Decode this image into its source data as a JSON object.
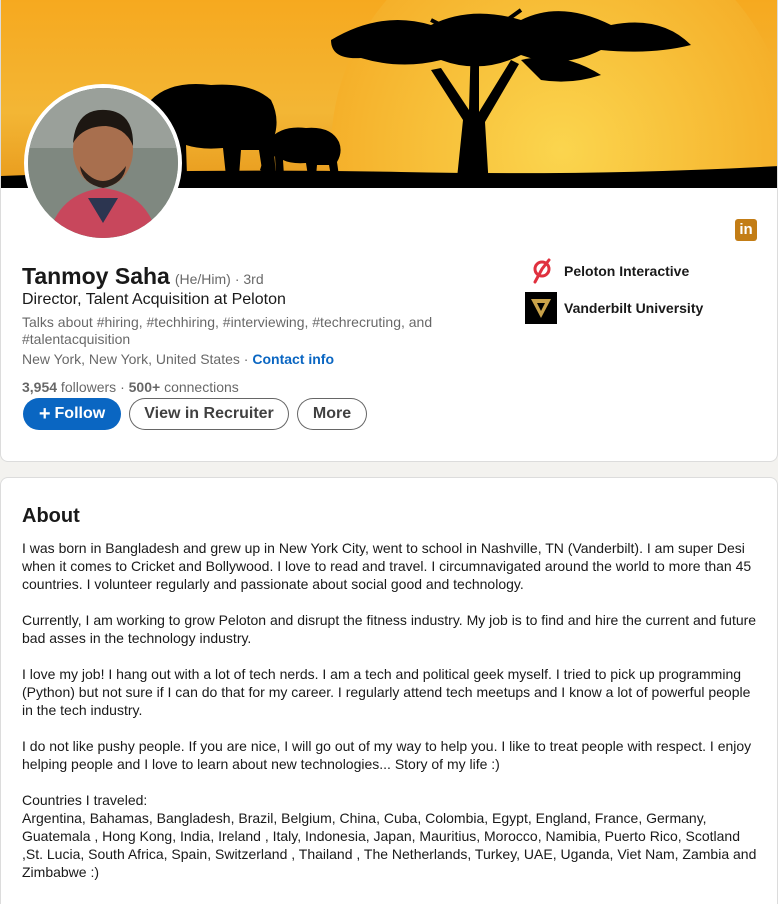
{
  "profile": {
    "name": "Tanmoy Saha",
    "pronouns": "(He/Him)",
    "degree": "· 3rd",
    "headline": "Director, Talent Acquisition at Peloton",
    "talks_about": "Talks about #hiring, #techhiring, #interviewing, #techrecruting, and #talentacquisition",
    "location": "New York, New York, United States",
    "location_separator": " · ",
    "contact_label": "Contact info",
    "followers_count": "3,954",
    "followers_label": " followers",
    "network_separator": " · ",
    "connections": "500+",
    "connections_label": " connections"
  },
  "actions": {
    "follow_plus": "+",
    "follow_label": "Follow",
    "recruiter_label": "View in Recruiter",
    "more_label": "More"
  },
  "orgs": [
    {
      "name": "Peloton Interactive",
      "icon": "peloton-logo"
    },
    {
      "name": "Vanderbilt University",
      "icon": "vanderbilt-logo"
    }
  ],
  "linkedin_badge": {
    "text": "in",
    "color": "#c37d16"
  },
  "about": {
    "title": "About",
    "paragraphs": [
      "I was born in Bangladesh and grew up in New York City, went to school in Nashville, TN (Vanderbilt). I am super Desi when it comes to Cricket and Bollywood. I love to read and travel. I circumnavigated around the world to more than 45 countries. I volunteer regularly and passionate about social good and technology.",
      "Currently, I am working to grow Peloton and disrupt the fitness industry. My job is to find and hire the current and future bad asses in the technology industry.",
      "I love my job! I hang out with a lot of tech nerds. I am a tech and political geek myself. I tried to pick up programming (Python) but not sure if I can do that for my career. I regularly attend tech meetups and I know a lot of powerful people in the tech industry.",
      "I do not like pushy people. If you are nice, I will go out of my way to help you. I like to treat people with respect. I enjoy helping people and I love to learn about new technologies... Story of my life :)",
      "Countries I traveled:",
      "Argentina, Bahamas, Bangladesh, Brazil, Belgium, China, Cuba, Colombia, Egypt, England, France, Germany, Guatemala , Hong Kong, India, Ireland , Italy, Indonesia, Japan, Mauritius, Morocco, Namibia, Puerto Rico, Scotland ,St. Lucia, South Africa, Spain, Switzerland , Thailand , The Netherlands, Turkey, UAE, Uganda, Viet Nam, Zambia and Zimbabwe :)"
    ]
  },
  "colors": {
    "link_blue": "#0a66c2",
    "banner_sky": "#f5b52a",
    "sun": "#f7c23c"
  }
}
